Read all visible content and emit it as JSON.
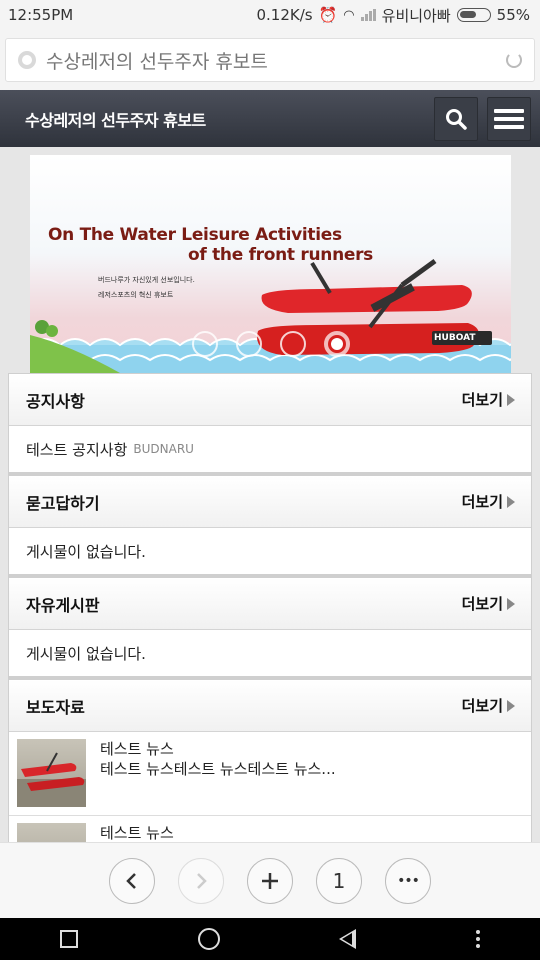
{
  "status_bar": {
    "time": "12:55PM",
    "network_speed": "0.12K/s",
    "carrier": "유비니아빠",
    "battery": "55%"
  },
  "address_bar": {
    "text": "수상레저의 선두주자 휴보트"
  },
  "site_header": {
    "title": "수상레저의 선두주자 휴보트"
  },
  "banner": {
    "headline_line1": "On The Water Leisure Activities",
    "headline_line2": "of the front runners",
    "sub_line1": "버드나루가 자신있게 선보입니다.",
    "sub_line2": "레저스포츠의 혁신 휴보트",
    "boat_label": "HUBOAT",
    "slides": 4,
    "active_slide": 4
  },
  "more_label": "더보기",
  "sections": {
    "notice": {
      "title": "공지사항",
      "item_title": "테스트 공지사항",
      "item_author": "BUDNARU"
    },
    "qna": {
      "title": "묻고답하기",
      "empty": "게시물이 없습니다."
    },
    "free_board": {
      "title": "자유게시판",
      "empty": "게시물이 없습니다."
    },
    "press": {
      "title": "보도자료",
      "items": [
        {
          "title": "테스트 뉴스",
          "summary": "테스트 뉴스테스트 뉴스테스트 뉴스..."
        },
        {
          "title": "테스트 뉴스",
          "summary": ""
        }
      ]
    }
  },
  "toolbar": {
    "tab_count": "1",
    "more_symbol": "•••"
  },
  "colors": {
    "header_bg": "#3a3e47",
    "banner_title": "#7a1c14",
    "boat_red": "#e0262a"
  }
}
